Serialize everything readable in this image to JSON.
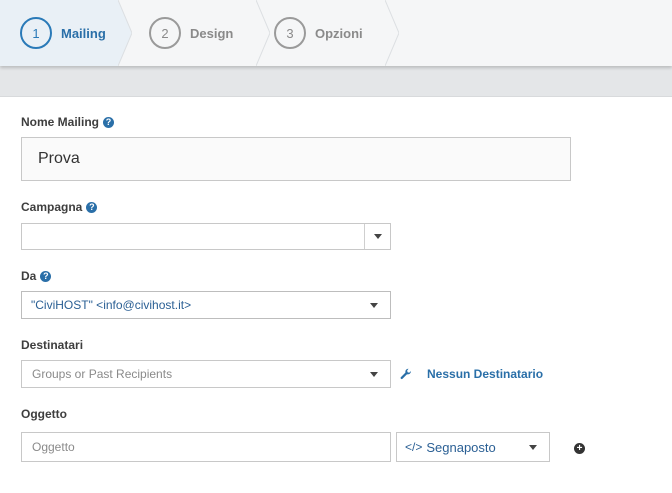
{
  "wizard": {
    "steps": [
      {
        "number": "1",
        "label": "Mailing",
        "active": true
      },
      {
        "number": "2",
        "label": "Design",
        "active": false
      },
      {
        "number": "3",
        "label": "Opzioni",
        "active": false
      }
    ]
  },
  "form": {
    "mailing_name": {
      "label": "Nome Mailing",
      "value": "Prova"
    },
    "campaign": {
      "label": "Campagna",
      "value": ""
    },
    "from": {
      "label": "Da",
      "value": "\"CiviHOST\" <info@civihost.it>"
    },
    "recipients": {
      "label": "Destinatari",
      "placeholder": "Groups or Past Recipients",
      "link": "Nessun Destinatario"
    },
    "subject": {
      "label": "Oggetto",
      "placeholder": "Oggetto",
      "token_label": "Segnaposto"
    }
  },
  "icons": {
    "help": "question-circle-icon",
    "wrench": "wrench-icon",
    "code": "code-icon",
    "plus": "plus-circle-icon",
    "dropdown": "caret-down-icon"
  },
  "colors": {
    "accent": "#2a6fa8",
    "active_step_bg": "#e9f0f6"
  }
}
